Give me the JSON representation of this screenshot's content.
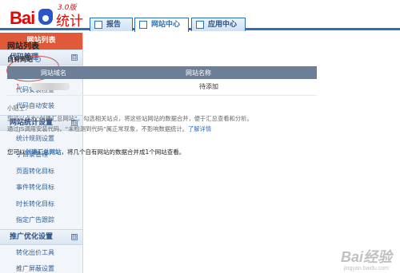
{
  "logo": {
    "brand": "Bai",
    "product": "统计",
    "version": "3.0版"
  },
  "tabs": [
    {
      "label": "报告",
      "active": false
    },
    {
      "label": "网站中心",
      "active": true
    },
    {
      "label": "应用中心",
      "active": false
    }
  ],
  "sidebar": {
    "top_item": "网站列表",
    "groups": [
      {
        "title": "代码管理",
        "toggle": "⊟",
        "items": [
          "代码获取",
          "代码安装检查",
          "代码自动安装"
        ]
      },
      {
        "title": "网站统计设置",
        "toggle": "⊟",
        "items": [
          "统计规则设置",
          "子目录管理",
          "页面转化目标",
          "事件转化目标",
          "时长转化目标",
          "指定广告跟踪"
        ]
      },
      {
        "title": "推广优化设置",
        "toggle": "⊟",
        "items": [
          "转化出价工具",
          "推广屏蔽设置"
        ]
      }
    ]
  },
  "main": {
    "title": "网站列表",
    "own_sites_label": "自有网站",
    "table": {
      "headers": [
        "",
        "网站域名",
        "网站名称"
      ],
      "rows": [
        {
          "index": "1",
          "domain": "",
          "name": "待添加"
        }
      ]
    },
    "tips_heading": "小贴士：",
    "tips_line1": "您可以点击“创建汇总网站”，勾选相关站点，将这些站网站的数据合并，便于汇总查看和分析。",
    "tips_line2": "通过JS调用安装代码，“未检测到代码”属正常现象，不影响数据统计。",
    "tips_link": "了解详情",
    "create_prefix": "您可以",
    "create_link": "创建汇总网站",
    "create_suffix": "，将几个自有网站的数据合并成1个网站查看。"
  },
  "watermark": {
    "text": "Bai经验",
    "url": "jingyan.baidu.com"
  },
  "colors": {
    "accent": "#2d6fb5",
    "active_nav": "#e05a3a",
    "annotation": "#d9534f"
  }
}
